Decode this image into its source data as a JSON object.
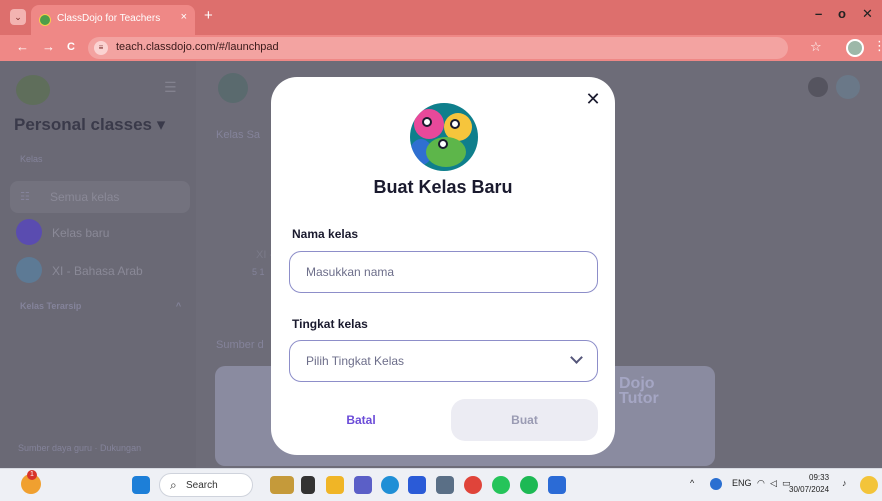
{
  "browser": {
    "tab_title": "ClassDojo for Teachers",
    "tab_close": "×",
    "new_tab": "+",
    "url": "teach.classdojo.com/#/launchpad",
    "back": "←",
    "forward": "→",
    "reload": "C",
    "bookmark": "☆",
    "menu": "⋮",
    "window_controls": {
      "minimize": "–",
      "maximize": "o",
      "close": "✕"
    }
  },
  "sidebar": {
    "heading": "Personal classes",
    "heading_caret": "▾",
    "section_label": "Kelas",
    "all_classes": "Semua kelas",
    "new_class": "Kelas baru",
    "class_item": "XI - Bahasa Arab",
    "archived": "Kelas Terarsip",
    "archived_caret": "^",
    "footer": "Sumber daya guru  ·  Dukungan"
  },
  "background": {
    "section": "Kelas Sa",
    "class_code": "XI -",
    "class_sub": "5 1",
    "resources": "Sumber d",
    "promo_text": "Dojo Tutor"
  },
  "modal": {
    "close": "✕",
    "title": "Buat Kelas Baru",
    "name_label": "Nama kelas",
    "name_placeholder": "Masukkan nama",
    "grade_label": "Tingkat kelas",
    "grade_placeholder": "Pilih Tingkat Kelas",
    "cancel": "Batal",
    "create": "Buat"
  },
  "taskbar": {
    "search": "Search",
    "lang": "ENG",
    "time": "09:33",
    "date": "30/07/2024",
    "badge": "1"
  }
}
